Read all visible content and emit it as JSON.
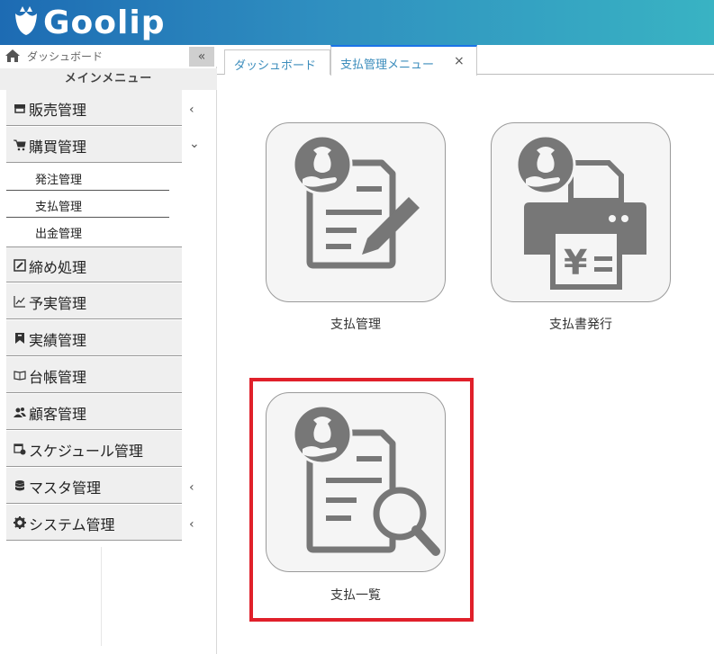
{
  "app": {
    "logo_text": "Goolip",
    "brand_colors": {
      "header_start": "#1d6bb3",
      "header_end": "#39b3c3",
      "highlight": "#e0202a",
      "tab_accent": "#1a73e8"
    }
  },
  "sidebar": {
    "dashboard_label": "ダッシュボード",
    "collapse_label": "«",
    "menu_title": "メインメニュー",
    "items": [
      {
        "label": "販売管理",
        "icon": "store-icon",
        "chevron": "‹"
      },
      {
        "label": "購買管理",
        "icon": "cart-icon",
        "chevron": "⌄",
        "children": [
          {
            "label": "発注管理"
          },
          {
            "label": "支払管理"
          },
          {
            "label": "出金管理"
          }
        ]
      },
      {
        "label": "締め処理",
        "icon": "edit-box-icon"
      },
      {
        "label": "予実管理",
        "icon": "line-chart-icon"
      },
      {
        "label": "実績管理",
        "icon": "bookmark-icon"
      },
      {
        "label": "台帳管理",
        "icon": "book-icon"
      },
      {
        "label": "顧客管理",
        "icon": "users-icon"
      },
      {
        "label": "スケジュール管理",
        "icon": "calendar-clock-icon"
      },
      {
        "label": "マスタ管理",
        "icon": "database-icon",
        "chevron": "‹"
      },
      {
        "label": "システム管理",
        "icon": "gear-icon",
        "chevron": "‹"
      }
    ]
  },
  "tabs": [
    {
      "label": "ダッシュボード"
    },
    {
      "label": "支払管理メニュー",
      "close": "×",
      "active": true
    }
  ],
  "cards": [
    {
      "label": "支払管理",
      "icon": "payment-edit-icon",
      "symbol": "¥"
    },
    {
      "label": "支払書発行",
      "icon": "payment-print-icon",
      "symbol": "¥"
    },
    {
      "label": "支払一覧",
      "icon": "payment-search-icon",
      "symbol": "¥",
      "highlighted": true
    }
  ]
}
